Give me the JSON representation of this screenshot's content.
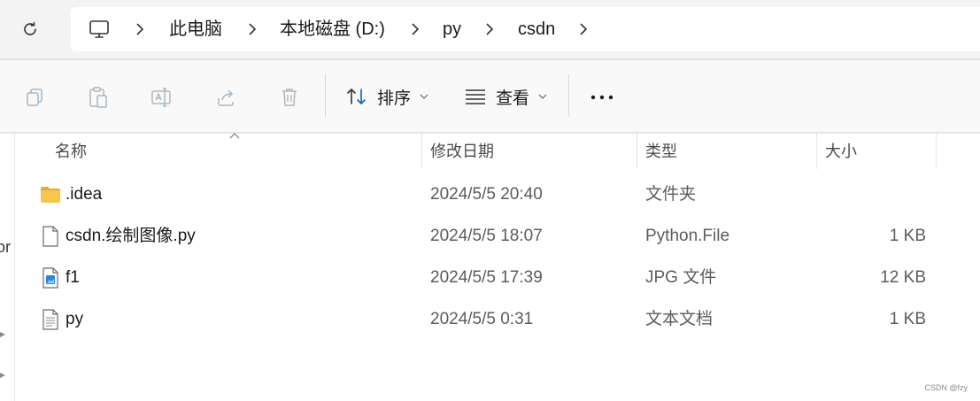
{
  "address": {
    "refresh_icon": "refresh-icon",
    "computer_icon": "computer-icon",
    "crumbs": [
      "此电脑",
      "本地磁盘 (D:)",
      "py",
      "csdn"
    ]
  },
  "toolbar": {
    "icons": [
      "copy-icon",
      "paste-icon",
      "rename-icon",
      "share-icon",
      "delete-icon"
    ],
    "sort_label": "排序",
    "view_label": "查看",
    "more_icon": "more-icon"
  },
  "columns": {
    "name": "名称",
    "date": "修改日期",
    "type": "类型",
    "size": "大小"
  },
  "files": [
    {
      "icon": "folder-icon",
      "name": ".idea",
      "date": "2024/5/5 20:40",
      "type": "文件夹",
      "size": ""
    },
    {
      "icon": "file-icon",
      "name": "csdn.绘制图像.py",
      "date": "2024/5/5 18:07",
      "type": "Python.File",
      "size": "1 KB"
    },
    {
      "icon": "image-file-icon",
      "name": "f1",
      "date": "2024/5/5 17:39",
      "type": "JPG 文件",
      "size": "12 KB"
    },
    {
      "icon": "text-file-icon",
      "name": "py",
      "date": "2024/5/5 0:31",
      "type": "文本文档",
      "size": "1 KB"
    }
  ],
  "nav_fragment": "or",
  "watermark": "CSDN @fzy",
  "colors": {
    "accent": "#0067c0",
    "folder": "#f8c64a"
  }
}
